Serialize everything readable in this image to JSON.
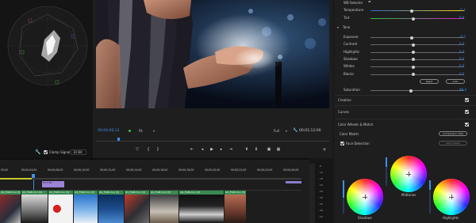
{
  "lumetri": {
    "wb_selector_label": "WB Selector",
    "temperature_label": "Temperature",
    "temperature_value": "-1.1",
    "tint_label": "Tint",
    "tint_value": "9.8",
    "tone_label": "Tone",
    "tone_rows": [
      {
        "label": "Exposure",
        "value": "-0.3"
      },
      {
        "label": "Contrast",
        "value": "0.0"
      },
      {
        "label": "Highlights",
        "value": "0.0"
      },
      {
        "label": "Shadows",
        "value": "0.0"
      },
      {
        "label": "Whites",
        "value": "0.0"
      },
      {
        "label": "Blacks",
        "value": "0.0"
      }
    ],
    "reset_label": "Reset",
    "auto_label": "Auto",
    "saturation_label": "Saturation",
    "saturation_value": "98.4",
    "creative_label": "Creative",
    "curves_label": "Curves",
    "wheels_section_label": "Color Wheels & Match",
    "color_match_label": "Color Match",
    "comparison_view_label": "Comparison View",
    "face_detection_label": "Face Detection",
    "apply_match_label": "Apply Match",
    "wheels": [
      {
        "label": "Midtones"
      },
      {
        "label": "Shadows"
      },
      {
        "label": "Highlights"
      }
    ],
    "accent_color": "#3d8fe8"
  },
  "program_monitor": {
    "timecode_in": "00;00;06;12",
    "zoom_option": "Fit",
    "quality_option": "Full",
    "timecode_duration": "00;01;12;00"
  },
  "scopes": {
    "clamp_signal_label": "Clamp Signal",
    "bit_depth_option": "10 Bit"
  },
  "timeline": {
    "ruler_ticks": [
      "00;00",
      "00;00;04;00",
      "00;00;08;00",
      "00;00;10;00",
      "00;00;12;00",
      "00;00;14;00",
      "00;00;16;00",
      "00;00;18;00",
      "00;00;20;00",
      "00;00;22;00",
      "00;00;24;00",
      "00;00;26;00"
    ],
    "fx_clip_label": "FX 1.0fr",
    "clips": [
      {
        "label": "GS_FGM.mov [V]",
        "color": "#3a8a52"
      },
      {
        "label": "GS_FGM.mov [V]",
        "color": "#3a8a52"
      },
      {
        "label": "GS_FGM.mov [V]",
        "color": "#3a8a52"
      },
      {
        "label": "GS_FGM.mov [V]",
        "color": "#3a8a52"
      },
      {
        "label": "GS_FGM.mov [V]",
        "color": "#3a8a52"
      },
      {
        "label": "GS_FGM.mov [V]",
        "color": "#3a8a52"
      },
      {
        "label": "GS_FGM.mov [V]",
        "color": "#3a8a52"
      },
      {
        "label": "GS_FGM.mov [V]",
        "color": "#3a8a52"
      },
      {
        "label": "GS_FGM.mov [V]",
        "color": "#3a8a52"
      }
    ],
    "meter_scale": [
      "-6",
      "-12",
      "-18",
      "-24",
      "-30",
      "-36",
      "-42",
      "-48",
      "-54"
    ]
  }
}
